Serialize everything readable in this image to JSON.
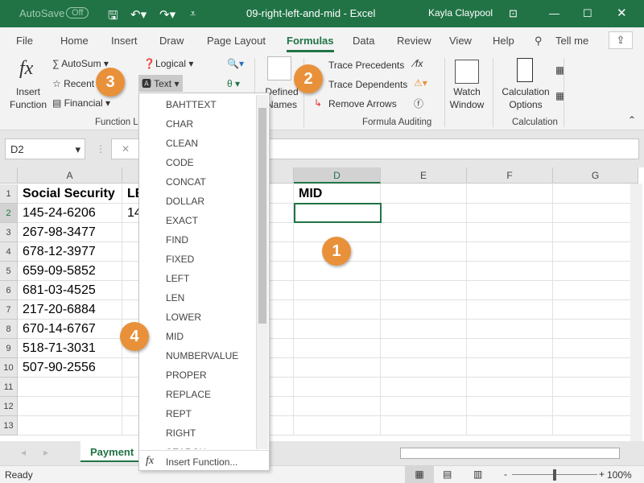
{
  "title_bar": {
    "autosave": "AutoSave",
    "autosave_state": "Off",
    "doc_title": "09-right-left-and-mid  -  Excel",
    "user": "Kayla Claypool"
  },
  "tabs": [
    "File",
    "Home",
    "Insert",
    "Draw",
    "Page Layout",
    "Formulas",
    "Data",
    "Review",
    "View",
    "Help",
    "Tell me"
  ],
  "active_tab": "Formulas",
  "ribbon": {
    "insert_function": "Insert Function",
    "autosum": "AutoSum",
    "recent": "Recent",
    "financial": "Financial",
    "logical": "Logical",
    "text": "Text",
    "defined_names": "Defined Names",
    "trace_precedents": "Trace Precedents",
    "trace_dependents": "Trace Dependents",
    "remove_arrows": "Remove Arrows",
    "watch_window": "Watch Window",
    "calc_options": "Calculation Options",
    "groups": {
      "function_library": "Function L",
      "formula_auditing": "Formula Auditing",
      "calculation": "Calculation"
    }
  },
  "formula_bar": {
    "name_box": "D2",
    "value": ""
  },
  "columns": [
    "A",
    "B",
    "C",
    "D",
    "E",
    "F",
    "G"
  ],
  "rows": [
    [
      "Social Security",
      "LE",
      "",
      "MID"
    ],
    [
      "145-24-6206",
      "14",
      "",
      ""
    ],
    [
      "267-98-3477"
    ],
    [
      "678-12-3977"
    ],
    [
      "659-09-5852"
    ],
    [
      "681-03-4525"
    ],
    [
      "217-20-6884"
    ],
    [
      "670-14-6767"
    ],
    [
      "518-71-3031"
    ],
    [
      "507-90-2556"
    ],
    [],
    [],
    []
  ],
  "dropdown": {
    "items": [
      "BAHTTEXT",
      "CHAR",
      "CLEAN",
      "CODE",
      "CONCAT",
      "DOLLAR",
      "EXACT",
      "FIND",
      "FIXED",
      "LEFT",
      "LEN",
      "LOWER",
      "MID",
      "NUMBERVALUE",
      "PROPER",
      "REPLACE",
      "REPT",
      "RIGHT",
      "SEARCH"
    ],
    "insert_function": "Insert Function..."
  },
  "callouts": [
    "1",
    "2",
    "3",
    "4"
  ],
  "sheet_tab": "Payment",
  "status": {
    "ready": "Ready",
    "zoom": "100%"
  },
  "colors": {
    "brand": "#217346",
    "callout": "#e8913a"
  }
}
